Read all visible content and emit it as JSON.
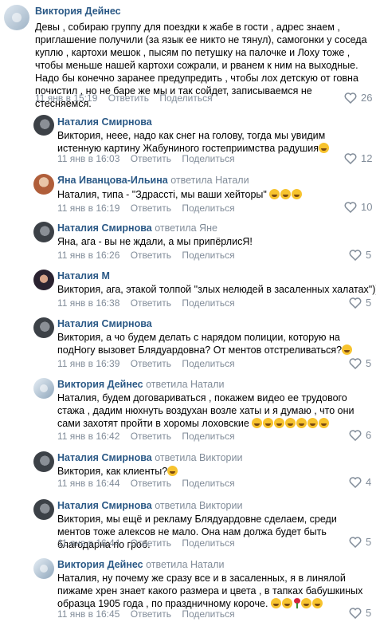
{
  "comments": [
    {
      "author": "Виктория Дейнес",
      "replied": "",
      "text": "Девы , собираю группу для поездки к жабе в гости , адрес знаем , приглашение получили (за язык ее никто не тянул), самогонки у соседа куплю , картохи мешок , пысям по петушку на палочке и Лоху тоже , чтобы меньше нашей картохи сожрали, и рванем к ним на выходные. Надо бы конечно заранее предупредить , чтобы лох детскую от говна почистил , но не баре же мы и так сойдет, записываемся не стесняемся.",
      "date": "11 янв в 15:19",
      "likes": "26"
    },
    {
      "author": "Наталия Смирнова",
      "replied": "",
      "text": "Виктория, неее, надо как снег на голову, тогда мы увидим истенную картину Жабуниного гостеприимства радушия",
      "date": "11 янв в 16:03",
      "likes": "12"
    },
    {
      "author": "Яна Иванцова-Ильина",
      "replied": "ответила Натали",
      "text": "Наталия, типа - \"Здрасстi, мы ваши хейторы\"",
      "date": "11 янв в 16:19",
      "likes": "10"
    },
    {
      "author": "Наталия Смирнова",
      "replied": "ответила Яне",
      "text": "Яна, ага - вы не ждали, а мы припёрлисЯ!",
      "date": "11 янв в 16:26",
      "likes": "5"
    },
    {
      "author": "Наталия М",
      "replied": "",
      "text": "Виктория, ага, этакой толпой \"злых нелюдей в засаленных халатах\")))",
      "date": "11 янв в 16:38",
      "likes": "5"
    },
    {
      "author": "Наталия Смирнова",
      "replied": "",
      "text": "Виктория, а чо будем делать с нарядом полиции, которую на подНогу вызовет Блядуардовна? От ментов отстреливаться?",
      "date": "11 янв в 16:39",
      "likes": "5"
    },
    {
      "author": "Виктория Дейнес",
      "replied": "ответила Натали",
      "text": "Наталия, будем договариваться , покажем видео ее трудового стажа , дадим нюхнуть воздухан возле хаты и я думаю , что они сами захотят пройти в хоромы лоховские",
      "date": "11 янв в 16:42",
      "likes": "6"
    },
    {
      "author": "Наталия Смирнова",
      "replied": "ответила Виктории",
      "text": "Виктория, как клиенты?",
      "date": "11 янв в 16:44",
      "likes": "4"
    },
    {
      "author": "Наталия Смирнова",
      "replied": "ответила Виктории",
      "text": "Виктория, мы ещё и рекламу Блядуардовне сделаем, среди ментов тоже алексов не мало. Она нам должа будет быть благодарна по гроб.",
      "date": "11 янв в 16:44",
      "likes": "5"
    },
    {
      "author": "Виктория Дейнес",
      "replied": "ответила Натали",
      "text": "Наталия, ну почему же сразу все и в засаленных, я в линялой пижаме хрен знает какого размера и цвета , в тапках бабушкиных образца 1905 года , по праздничному короче.",
      "date": "11 янв в 16:45",
      "likes": "5"
    }
  ],
  "actions": {
    "reply": "Ответить",
    "share": "Поделиться"
  },
  "icons": {
    "like": "heart-outline-icon",
    "emoji": "laughing-emoji-icon",
    "rose": "rose-emoji-icon"
  },
  "colors": {
    "author": "#2a5885",
    "muted": "#818c99",
    "text": "#000000"
  }
}
